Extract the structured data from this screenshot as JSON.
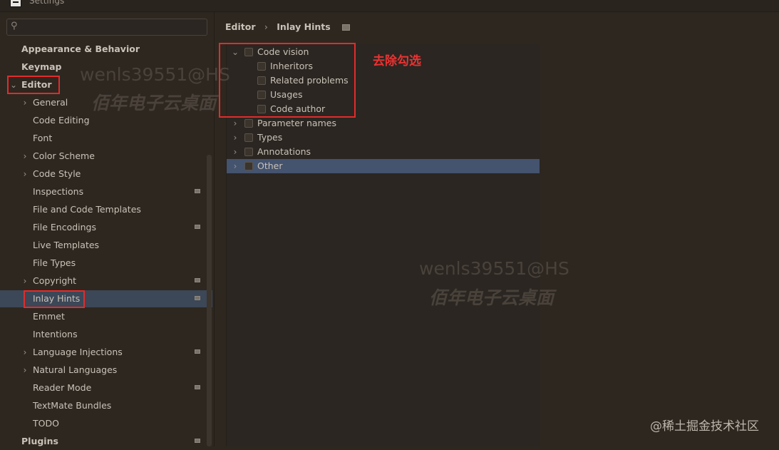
{
  "window": {
    "title": "Settings"
  },
  "search": {
    "placeholder": "",
    "value": ""
  },
  "sidebar": {
    "items": [
      {
        "label": "Appearance & Behavior",
        "level": 0,
        "bold": true,
        "chevron": ""
      },
      {
        "label": "Keymap",
        "level": 0,
        "bold": true,
        "chevron": ""
      },
      {
        "label": "Editor",
        "level": 0,
        "bold": true,
        "chevron": "⌄"
      },
      {
        "label": "General",
        "level": 1,
        "chevron": "›"
      },
      {
        "label": "Code Editing",
        "level": 1,
        "chevron": ""
      },
      {
        "label": "Font",
        "level": 1,
        "chevron": ""
      },
      {
        "label": "Color Scheme",
        "level": 1,
        "chevron": "›"
      },
      {
        "label": "Code Style",
        "level": 1,
        "chevron": "›"
      },
      {
        "label": "Inspections",
        "level": 1,
        "chevron": "",
        "badge": true
      },
      {
        "label": "File and Code Templates",
        "level": 1,
        "chevron": ""
      },
      {
        "label": "File Encodings",
        "level": 1,
        "chevron": "",
        "badge": true
      },
      {
        "label": "Live Templates",
        "level": 1,
        "chevron": ""
      },
      {
        "label": "File Types",
        "level": 1,
        "chevron": ""
      },
      {
        "label": "Copyright",
        "level": 1,
        "chevron": "›",
        "badge": true
      },
      {
        "label": "Inlay Hints",
        "level": 1,
        "chevron": "",
        "badge": true,
        "selected": true
      },
      {
        "label": "Emmet",
        "level": 1,
        "chevron": ""
      },
      {
        "label": "Intentions",
        "level": 1,
        "chevron": ""
      },
      {
        "label": "Language Injections",
        "level": 1,
        "chevron": "›",
        "badge": true
      },
      {
        "label": "Natural Languages",
        "level": 1,
        "chevron": "›"
      },
      {
        "label": "Reader Mode",
        "level": 1,
        "chevron": "",
        "badge": true
      },
      {
        "label": "TextMate Bundles",
        "level": 1,
        "chevron": ""
      },
      {
        "label": "TODO",
        "level": 1,
        "chevron": ""
      },
      {
        "label": "Plugins",
        "level": 0,
        "bold": true,
        "chevron": "",
        "badge": true
      }
    ]
  },
  "breadcrumb": {
    "parent": "Editor",
    "separator": "›",
    "current": "Inlay Hints"
  },
  "hints": [
    {
      "label": "Code vision",
      "level": 0,
      "chevron": "⌄",
      "checked": false
    },
    {
      "label": "Inheritors",
      "level": 1,
      "chevron": "",
      "checked": false
    },
    {
      "label": "Related problems",
      "level": 1,
      "chevron": "",
      "checked": false
    },
    {
      "label": "Usages",
      "level": 1,
      "chevron": "",
      "checked": false
    },
    {
      "label": "Code author",
      "level": 1,
      "chevron": "",
      "checked": false
    },
    {
      "label": "Parameter names",
      "level": 0,
      "chevron": "›",
      "checked": false
    },
    {
      "label": "Types",
      "level": 0,
      "chevron": "›",
      "checked": false
    },
    {
      "label": "Annotations",
      "level": 0,
      "chevron": "›",
      "checked": false
    },
    {
      "label": "Other",
      "level": 0,
      "chevron": "›",
      "checked": false,
      "selected": true
    }
  ],
  "annotation": {
    "note": "去除勾选",
    "color": "#e02c2c"
  },
  "watermark": {
    "line1": "wenls39551@HS",
    "line2": "佰年电子云桌面"
  },
  "footer_watermark": "@稀土掘金技术社区",
  "colors": {
    "selection_sidebar": "#3c4757",
    "selection_hint": "#44536e",
    "background": "#2d2720"
  }
}
